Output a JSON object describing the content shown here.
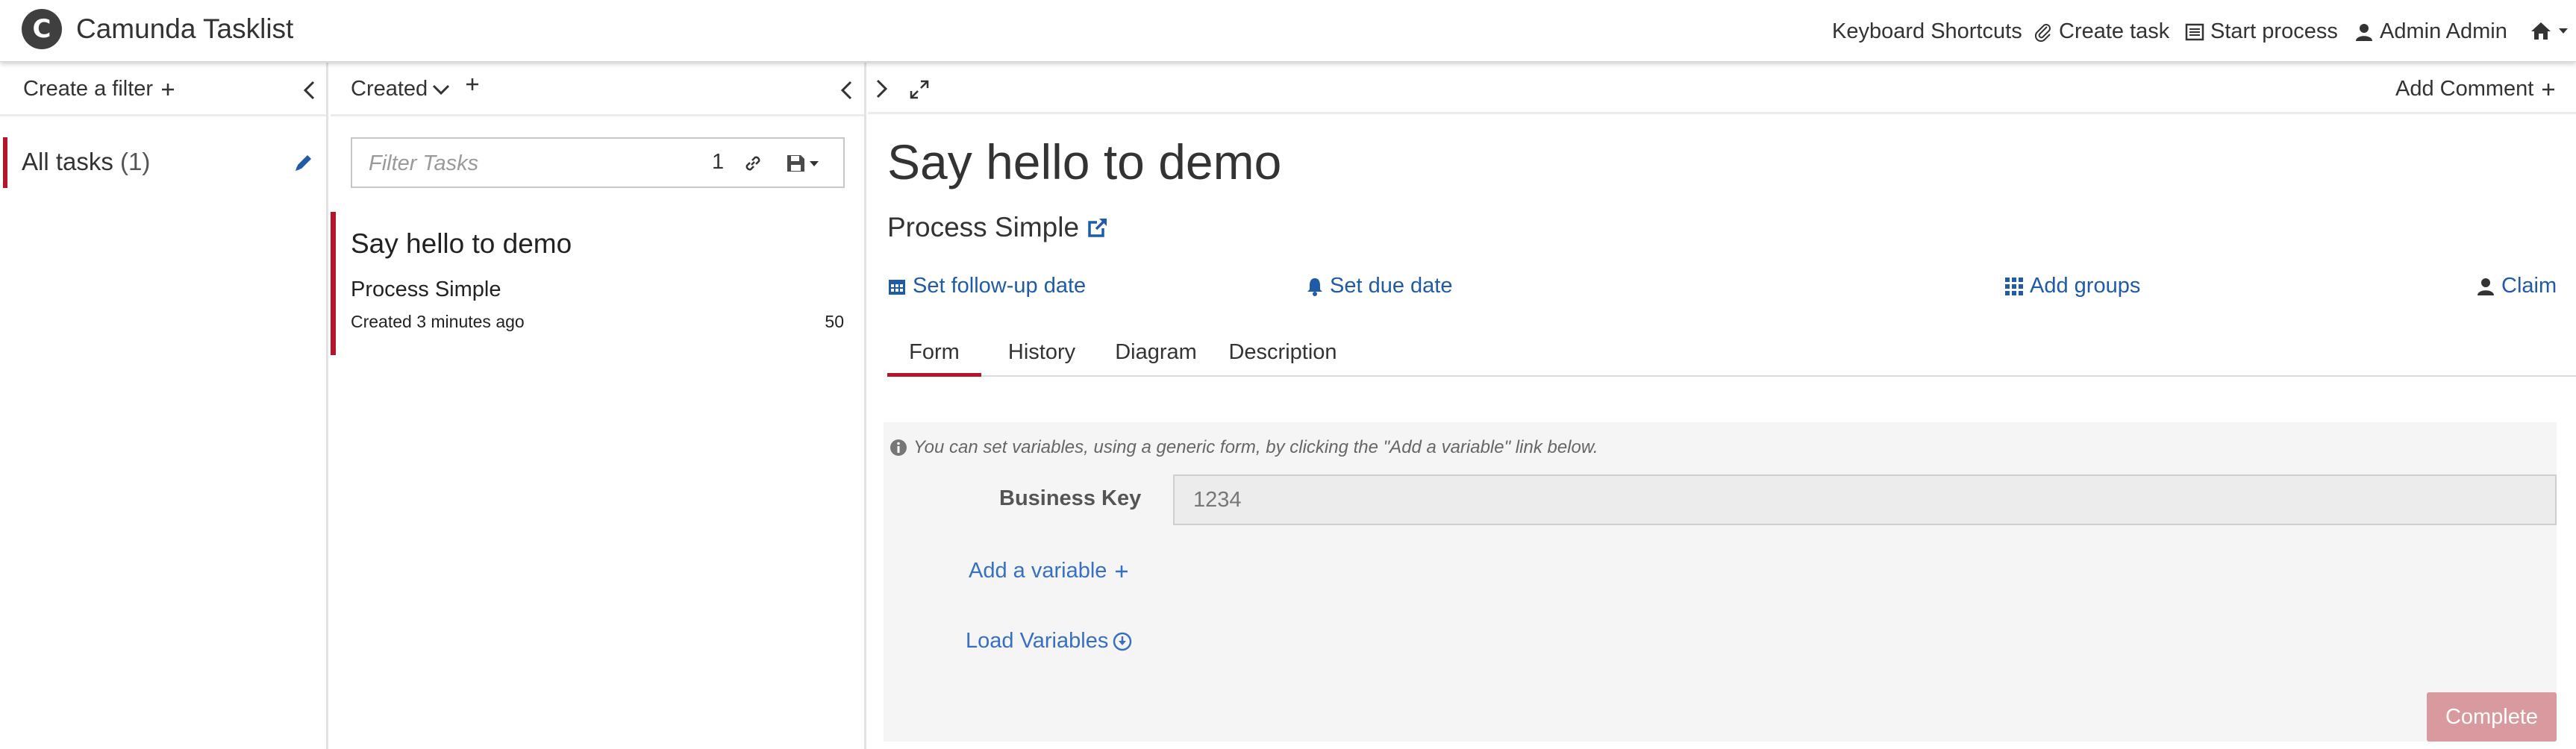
{
  "header": {
    "app_title": "Camunda Tasklist",
    "logo_letter": "C",
    "keyboard_shortcuts": "Keyboard Shortcuts",
    "create_task": "Create task",
    "start_process": "Start process",
    "user_name": "Admin Admin"
  },
  "filters": {
    "create_filter": "Create a filter",
    "items": [
      {
        "label": "All tasks",
        "count": "(1)"
      }
    ]
  },
  "list": {
    "sort_label": "Created",
    "search": {
      "placeholder": "Filter Tasks",
      "count": "1"
    },
    "tasks": [
      {
        "name": "Say hello to demo",
        "process": "Process Simple",
        "created": "Created 3 minutes ago",
        "priority": "50"
      }
    ]
  },
  "task": {
    "add_comment": "Add Comment",
    "title": "Say hello to demo",
    "process": "Process Simple",
    "actions": {
      "follow_up": "Set follow-up date",
      "due_date": "Set due date",
      "add_groups": "Add groups",
      "claim": "Claim"
    },
    "tabs": [
      "Form",
      "History",
      "Diagram",
      "Description"
    ],
    "active_tab": "Form",
    "form": {
      "hint": "You can set variables, using a generic form, by clicking the \"Add a variable\" link below.",
      "business_key_label": "Business Key",
      "business_key_value": "1234",
      "add_variable": "Add a variable",
      "load_variables": "Load Variables",
      "complete": "Complete"
    }
  },
  "colors": {
    "accent": "#b5152b",
    "link": "#1f5ba6",
    "complete_disabled": "#d99a9f"
  }
}
